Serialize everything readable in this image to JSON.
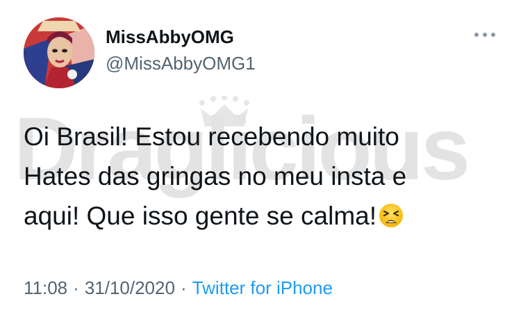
{
  "user": {
    "display_name": "MissAbbyOMG",
    "handle": "@MissAbbyOMG1",
    "avatar_icon": "profile-photo"
  },
  "more_icon": "more-options-icon",
  "tweet": {
    "lines": [
      "Oi Brasil! Estou recebendo muito",
      "Hates das gringas no meu insta e",
      "aqui! Que isso gente se calma!"
    ],
    "emoji": "tired-face-emoji"
  },
  "meta": {
    "time": "11:08",
    "separator": "·",
    "date": "31/10/2020",
    "source": "Twitter for iPhone"
  },
  "watermark": {
    "text": "Draglicious"
  },
  "colors": {
    "text": "#0f1419",
    "secondary": "#536471",
    "link": "#1d9bf0",
    "watermark": "#e3e3e3"
  }
}
